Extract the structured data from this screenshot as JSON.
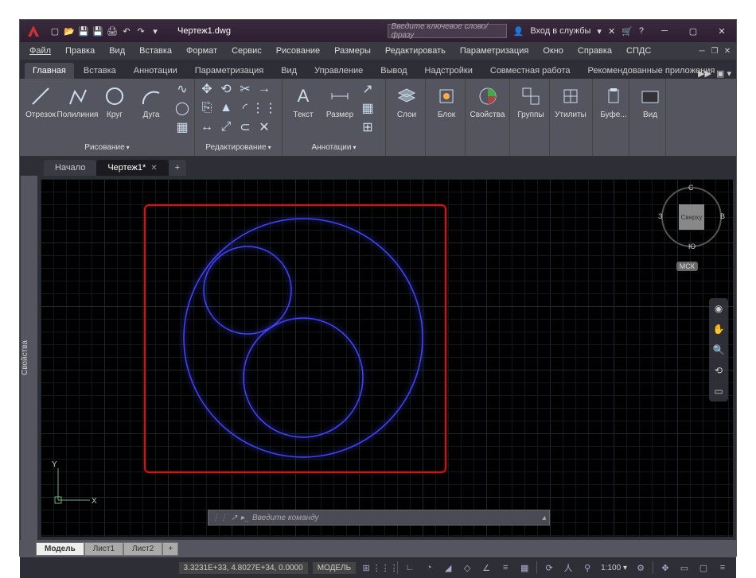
{
  "title": "Чертеж1.dwg",
  "search_placeholder": "Введите ключевое слово/фразу",
  "signin": "Вход в службы",
  "menu": [
    "Файл",
    "Правка",
    "Вид",
    "Вставка",
    "Формат",
    "Сервис",
    "Рисование",
    "Размеры",
    "Редактировать",
    "Параметризация",
    "Окно",
    "Справка",
    "СПДС"
  ],
  "ribbon_tabs": [
    "Главная",
    "Вставка",
    "Аннотации",
    "Параметризация",
    "Вид",
    "Управление",
    "Вывод",
    "Надстройки",
    "Совместная работа",
    "Рекомендованные приложения"
  ],
  "active_ribbon_tab": 0,
  "panels": {
    "draw": {
      "title": "Рисование",
      "items": [
        "Отрезок",
        "Полилиния",
        "Круг",
        "Дуга"
      ]
    },
    "edit": {
      "title": "Редактирование"
    },
    "anno": {
      "title": "Аннотации",
      "items": [
        "Текст",
        "Размер"
      ]
    },
    "layers": {
      "title": "Слои"
    },
    "block": {
      "title": "Блок"
    },
    "props": {
      "title": "Свойства"
    },
    "groups": {
      "title": "Группы"
    },
    "utils": {
      "title": "Утилиты"
    },
    "clip": {
      "title": "Буфе..."
    },
    "view": {
      "title": "Вид"
    }
  },
  "doc_tabs": [
    {
      "label": "Начало",
      "active": false,
      "closable": false
    },
    {
      "label": "Чертеж1*",
      "active": true,
      "closable": true
    }
  ],
  "props_sidebar": "Свойства",
  "viewcube": {
    "top": "Сверху",
    "n": "С",
    "s": "Ю",
    "e": "В",
    "w": "З"
  },
  "mcs": "МСК",
  "ucs": {
    "x": "X",
    "y": "Y"
  },
  "command_placeholder": "Введите команду",
  "layout_tabs": [
    "Модель",
    "Лист1",
    "Лист2"
  ],
  "active_layout": 0,
  "status": {
    "coords": "3.3231E+33, 4.8027E+34, 0.0000",
    "model": "МОДЕЛЬ",
    "scale": "1:100"
  }
}
